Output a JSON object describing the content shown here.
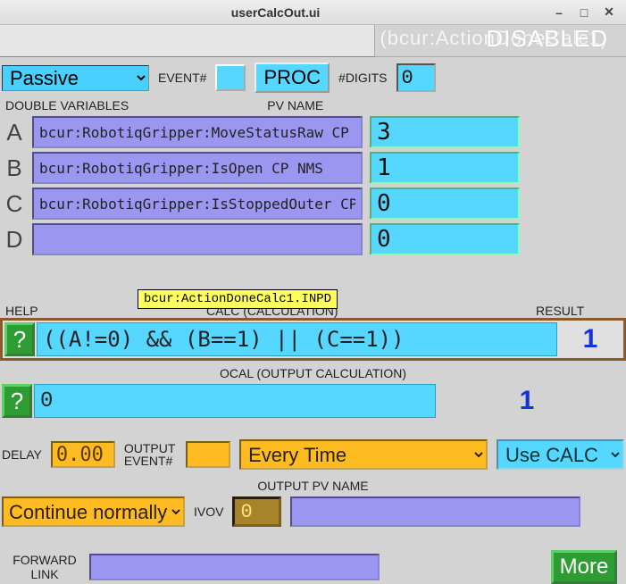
{
  "window": {
    "title": "userCalcOut.ui"
  },
  "header": {
    "overlay": "(bcur:ActionDoneCalc1)",
    "overlay2": "DISABLED"
  },
  "row1": {
    "scan_options": [
      "Passive"
    ],
    "scan_value": "Passive",
    "event_label": "EVENT#",
    "proc_label": "PROC",
    "ndigits_label": "#DIGITS",
    "ndigits_value": "0"
  },
  "var_section": {
    "col1": "DOUBLE VARIABLES",
    "col2": "PV NAME"
  },
  "vars": [
    {
      "letter": "A",
      "pv": "bcur:RobotiqGripper:MoveStatusRaw CP NM",
      "val": "3"
    },
    {
      "letter": "B",
      "pv": "bcur:RobotiqGripper:IsOpen CP NMS",
      "val": "1"
    },
    {
      "letter": "C",
      "pv": "bcur:RobotiqGripper:IsStoppedOuter CP N",
      "val": "0"
    },
    {
      "letter": "D",
      "pv": "",
      "val": "0"
    }
  ],
  "tooltip": "bcur:ActionDoneCalc1.INPD",
  "calc": {
    "help_label": "HELP",
    "title": "CALC (CALCULATION)",
    "result_label": "RESULT",
    "help_btn": "?",
    "expr": "((A!=0) && (B==1) || (C==1))",
    "result": "1"
  },
  "ocal": {
    "title": "OCAL (OUTPUT CALCULATION)",
    "help_btn": "?",
    "expr": "0",
    "result": "1"
  },
  "delay": {
    "label": "DELAY",
    "value": "0.00",
    "output_event_label": "OUTPUT\nEVENT#",
    "oopt_options": [
      "Every Time"
    ],
    "oopt_value": "Every Time",
    "dopt_options": [
      "Use CALC"
    ],
    "dopt_value": "Use CALC"
  },
  "out": {
    "title": "OUTPUT PV NAME",
    "ivoa_options": [
      "Continue normally"
    ],
    "ivoa_value": "Continue normally",
    "ivov_label": "IVOV",
    "ivov_value": "0",
    "out_pv": ""
  },
  "fwd": {
    "label": "FORWARD\nLINK",
    "value": "",
    "more": "More"
  }
}
